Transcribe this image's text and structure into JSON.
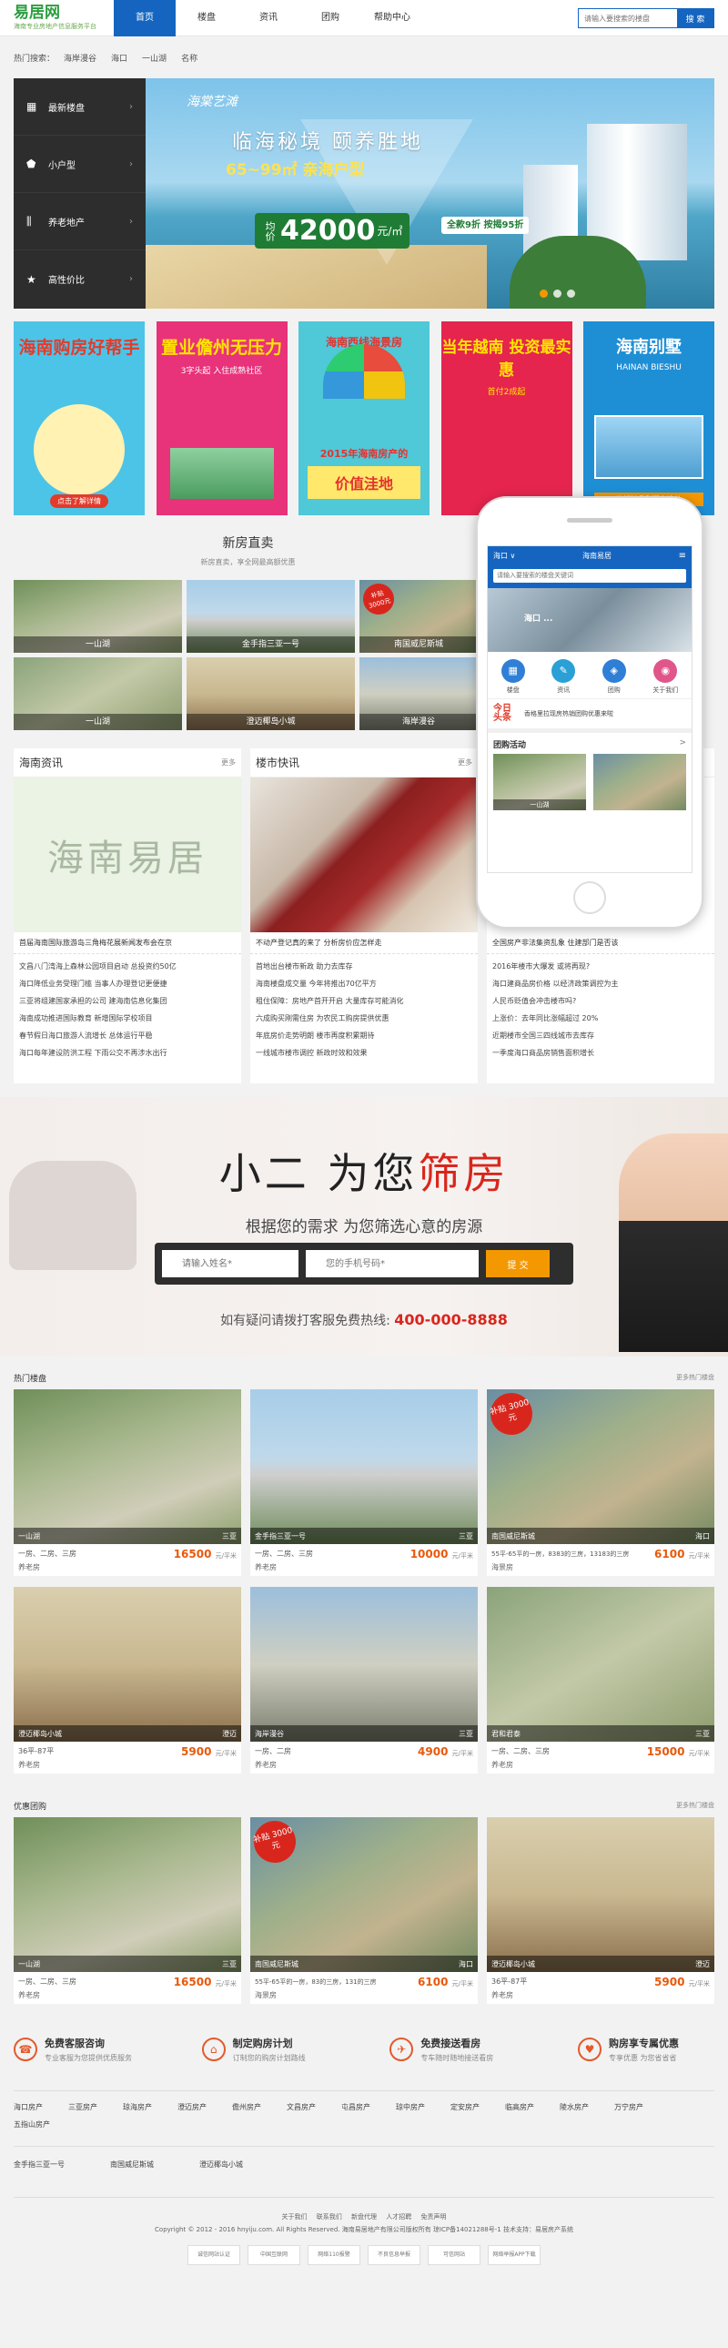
{
  "header": {
    "logo": "易居网",
    "logo_sub": "海南专业房地产信息服务平台",
    "nav": [
      "首页",
      "楼盘",
      "资讯",
      "团购",
      "帮助中心"
    ],
    "search_placeholder": "请输入要搜索的楼盘",
    "search_btn": "搜 索"
  },
  "hot": {
    "label": "热门搜索：",
    "items": [
      "海岸漫谷",
      "海口",
      "一山湖",
      "名称"
    ]
  },
  "hero": {
    "menu": [
      {
        "icon": "▦",
        "label": "最新楼盘"
      },
      {
        "icon": "⬟",
        "label": "小户型"
      },
      {
        "icon": "⫼",
        "label": "养老地产"
      },
      {
        "icon": "★",
        "label": "高性价比"
      }
    ],
    "brand": "海棠艺滩",
    "h1": "临海秘境 颐养胜地",
    "h2": "65~99㎡ 亲海户型",
    "unit": "均价",
    "price": "42000",
    "yuan": "元/㎡",
    "discount": "全款9折 按揭95折"
  },
  "posters": [
    {
      "t": "海南购房好帮手",
      "s": "",
      "tag": "点击了解详情"
    },
    {
      "t": "置业儋州无压力",
      "s": "3字头起 入住成熟社区"
    },
    {
      "t": "海南西线海景房",
      "s": "2015年海南房产的",
      "y": "价值洼地"
    },
    {
      "t": "当年越南 投资最实惠",
      "s": "首付2成起"
    },
    {
      "t": "海南别墅",
      "s": "HAINAN BIESHU",
      "b": "热销精品别墅在这儿"
    }
  ],
  "newhouse": {
    "title": "新房直卖",
    "sub": "新房直卖，享全网最高额优惠",
    "cells": [
      "一山湖",
      "金手指三亚一号",
      "南国威尼斯城",
      "澄迈椰岛小城",
      "海岸漫谷",
      ""
    ],
    "badge": "补贴 3000元"
  },
  "phone": {
    "city": "海口 ∨",
    "title": "海南易居",
    "search": "请输入要搜索的楼盘关键词",
    "banner": "海口 ...",
    "icons": [
      {
        "i": "▦",
        "l": "楼盘",
        "c": "#2f7fd6"
      },
      {
        "i": "✎",
        "l": "资讯",
        "c": "#2aa0d6"
      },
      {
        "i": "◈",
        "l": "团购",
        "c": "#2f7fd6"
      },
      {
        "i": "◉",
        "l": "关于我们",
        "c": "#e0568a"
      }
    ],
    "hl_title": "今日头条",
    "hl_text": "香格里拉现房热销团购优惠来啦",
    "group": "团购活动",
    "more": ">",
    "ims": [
      "一山湖",
      ""
    ]
  },
  "news": [
    {
      "title": "海南资讯",
      "more": "更多",
      "img": "海南易居",
      "lead": "首届海南国际旅游岛三角梅花展新闻发布会在京",
      "items": [
        "文昌八门湾海上森林公园项目启动 总投资约50亿",
        "海口降低业务受理门槛 当事人办理登记更便捷",
        "三亚将组建国家承担的公司 建海南信息化集团",
        "海南成功推进国际教育 新增国际学校项目",
        "春节假日海口旅游人流增长 总体运行平稳",
        "海口每年建设防洪工程 下雨公交不再涉水出行"
      ]
    },
    {
      "title": "楼市快讯",
      "more": "更多",
      "lead": "不动产登记真的来了 分析房价应怎样走",
      "items": [
        "首地出台楼市新政 助力去库存",
        "海南楼盘成交量 今年将推出70亿平方",
        "租住保障：房地产首开开启 大量库存可能消化",
        "六成购买刚需住房 为农民工购房提供优惠",
        "年底房价走势明朗 楼市再度积累期待",
        "一线城市楼市调控 新政时效和效果"
      ]
    },
    {
      "title": "",
      "more": "",
      "lead": "全国房产非法集资乱象 住建部门是否该",
      "items": [
        "2016年楼市大爆发 或将再现?",
        "海口建商品房价格 以经济政策调控为主",
        "人民币贬值会冲击楼市吗?",
        "上涨价：去年同比涨幅超过 20%",
        "近期楼市全国三四线城市去库存",
        "一季度海口商品房销售面积增长"
      ]
    }
  ],
  "promo": {
    "t1": "小二",
    "t2": "为您",
    "t3": "筛房",
    "sub": "根据您的需求 为您筛选心意的房源",
    "ph_name": "请输入姓名*",
    "ph_phone": "您的手机号码*",
    "btn": "提 交",
    "tel_label": "如有疑问请拨打客服免费热线:",
    "tel": "400-000-8888"
  },
  "hotlist": {
    "title": "热门楼盘",
    "more": "更多热门楼盘",
    "cards": [
      {
        "name": "一山湖",
        "area": "三亚",
        "desc": "一房、二房、三房",
        "price": "16500",
        "unit": "元/平米",
        "tag": "养老房"
      },
      {
        "name": "金手指三亚一号",
        "area": "三亚",
        "desc": "一房、二房、三房",
        "price": "10000",
        "unit": "元/平米",
        "tag": "养老房"
      },
      {
        "name": "南国威尼斯城",
        "area": "海口",
        "desc": "55平-65平的一房，8383的三房，13183的三房",
        "price": "6100",
        "unit": "元/平米",
        "tag": "海景房"
      },
      {
        "name": "澄迈椰岛小城",
        "area": "澄迈",
        "desc": "36平-87平",
        "price": "5900",
        "unit": "元/平米",
        "tag": "养老房"
      },
      {
        "name": "海岸漫谷",
        "area": "三亚",
        "desc": "一房、二房",
        "price": "4900",
        "unit": "元/平米",
        "tag": "养老房"
      },
      {
        "name": "君和君泰",
        "area": "三亚",
        "desc": "一房、二房、三房",
        "price": "15000",
        "unit": "元/平米",
        "tag": "养老房"
      }
    ]
  },
  "grouplist": {
    "title": "优惠团购",
    "more": "更多热门楼盘",
    "cards": [
      {
        "name": "一山湖",
        "area": "三亚",
        "desc": "一房、二房、三房",
        "price": "16500",
        "unit": "元/平米",
        "tag": "养老房"
      },
      {
        "name": "南国威尼斯城",
        "area": "海口",
        "desc": "55平-65平的一房，83的三房，131的三房",
        "price": "6100",
        "unit": "元/平米",
        "tag": "海景房"
      },
      {
        "name": "澄迈椰岛小城",
        "area": "澄迈",
        "desc": "36平-87平",
        "price": "5900",
        "unit": "元/平米",
        "tag": "养老房"
      }
    ]
  },
  "features": [
    {
      "i": "☎",
      "t": "免费客服咨询",
      "s": "专业客服为您提供优质服务"
    },
    {
      "i": "⌂",
      "t": "制定购房计划",
      "s": "订制您的购房计划路线"
    },
    {
      "i": "✈",
      "t": "免费接送看房",
      "s": "专车随时随地接送看房"
    },
    {
      "i": "♥",
      "t": "购房享专属优惠",
      "s": "专享优惠 为您省省省"
    }
  ],
  "citylinks": [
    "海口房产",
    "三亚房产",
    "琼海房产",
    "澄迈房产",
    "儋州房产",
    "文昌房产",
    "屯昌房产",
    "琼中房产",
    "定安房产",
    "临高房产",
    "陵水房产",
    "万宁房产",
    "五指山房产"
  ],
  "friendlinks": [
    "金手指三亚一号",
    "南国威尼斯城",
    "澄迈椰岛小城"
  ],
  "footer": {
    "links": [
      "关于我们",
      "联系我们",
      "新盘代理",
      "人才招聘",
      "免责声明"
    ],
    "copy": "Copyright © 2012 - 2016 hnyiju.com. All Rights Reserved. 海南易居地产有限公司版权所有   琼ICP备14021288号-1   技术支持：易居房产系统",
    "badges": [
      "诚信网站认证",
      "中国互联网",
      "网络110报警",
      "不良信息举报",
      "可信网站",
      "网络举报APP下载"
    ]
  }
}
